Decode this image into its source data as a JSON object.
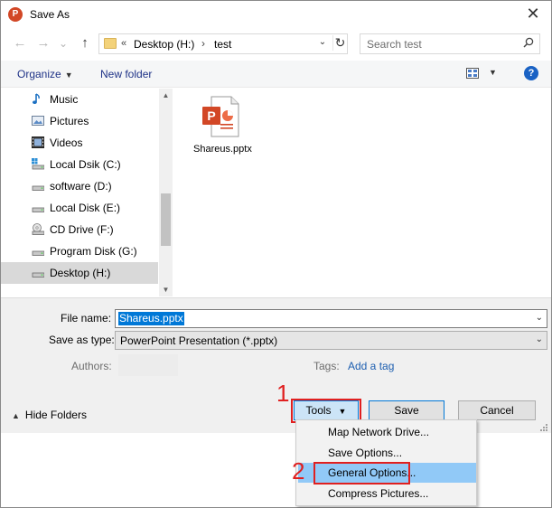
{
  "window": {
    "title": "Save As",
    "app_icon_letter": "P",
    "close_glyph": "✕"
  },
  "navbar": {
    "back_glyph": "←",
    "forward_glyph": "→",
    "recent_glyph": "⌄",
    "up_glyph": "↑",
    "address": {
      "overflow": "«",
      "crumbs": [
        "Desktop (H:)",
        "test"
      ],
      "separator": "›",
      "dropdown_glyph": "⌄",
      "refresh_glyph": "↻"
    },
    "search_placeholder": "Search test"
  },
  "toolbar": {
    "organize_label": "Organize",
    "new_folder_label": "New folder",
    "dd_glyph": "▼",
    "help_glyph": "?"
  },
  "nav_pane": {
    "items": [
      {
        "label": "Music",
        "icon": "music-icon",
        "selected": false
      },
      {
        "label": "Pictures",
        "icon": "pictures-icon",
        "selected": false
      },
      {
        "label": "Videos",
        "icon": "videos-icon",
        "selected": false
      },
      {
        "label": "Local Dsik (C:)",
        "icon": "system-drive-icon",
        "selected": false
      },
      {
        "label": "software (D:)",
        "icon": "drive-icon",
        "selected": false
      },
      {
        "label": "Local Disk (E:)",
        "icon": "drive-icon",
        "selected": false
      },
      {
        "label": "CD Drive (F:)",
        "icon": "cd-drive-icon",
        "selected": false
      },
      {
        "label": "Program Disk  (G:)",
        "icon": "drive-icon",
        "selected": false
      },
      {
        "label": "Desktop (H:)",
        "icon": "drive-icon",
        "selected": true
      }
    ],
    "scroll_up_glyph": "▲",
    "scroll_down_glyph": "▼"
  },
  "files": [
    {
      "name": "Shareus.pptx",
      "icon": "powerpoint-file-icon"
    }
  ],
  "form": {
    "file_name_label": "File name:",
    "file_name_value": "Shareus.pptx",
    "save_type_label": "Save as type:",
    "save_type_value": "PowerPoint Presentation (*.pptx)",
    "authors_label": "Authors:",
    "tags_label": "Tags:",
    "tags_link": "Add a tag",
    "dd_glyph": "⌄"
  },
  "footer": {
    "hide_folders_label": "Hide Folders",
    "hide_folders_glyph": "▲",
    "tools_label": "Tools",
    "tools_dd_glyph": "▼",
    "save_label": "Save",
    "cancel_label": "Cancel"
  },
  "tools_menu": {
    "items": [
      {
        "label": "Map Network Drive...",
        "highlighted": false
      },
      {
        "label": "Save Options...",
        "highlighted": false
      },
      {
        "label": "General Options...",
        "highlighted": true
      },
      {
        "label": "Compress Pictures...",
        "highlighted": false
      }
    ]
  },
  "annotations": {
    "step1": "1",
    "step2": "2",
    "color": "#e02020"
  },
  "colors": {
    "accent": "#0078d7",
    "link": "#1e5fb0",
    "selection": "#d9d9d9",
    "menu_highlight": "#91c9f7",
    "powerpoint": "#d24726"
  }
}
